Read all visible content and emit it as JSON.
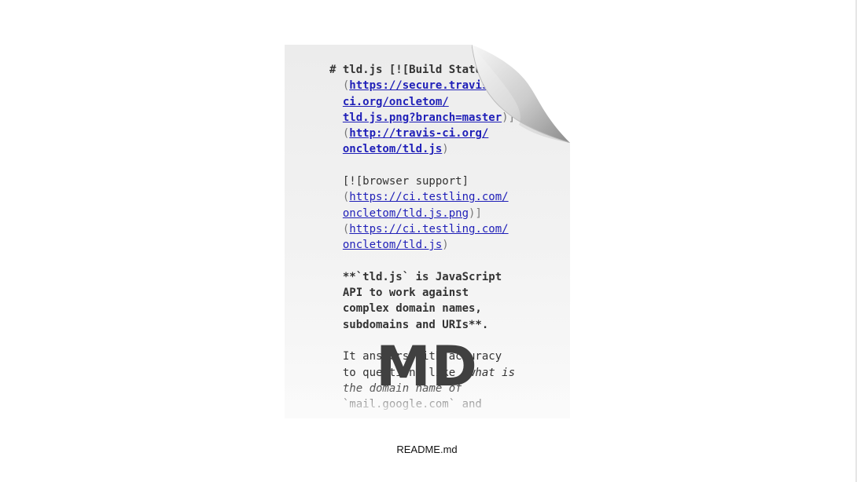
{
  "file": {
    "name": "README.md",
    "type_badge": "MD"
  },
  "preview": {
    "lines": [
      {
        "parts": [
          {
            "t": "# ",
            "c": "b"
          },
          {
            "t": "tld.js ",
            "c": "b"
          },
          {
            "t": "[![Build Status]",
            "c": "b"
          }
        ]
      },
      {
        "parts": [
          {
            "t": "  (",
            "c": "gray"
          },
          {
            "t": "https://secure.travis-",
            "c": "lnk"
          }
        ]
      },
      {
        "parts": [
          {
            "t": "  ",
            "c": ""
          },
          {
            "t": "ci.org/oncletom/",
            "c": "lnk"
          }
        ]
      },
      {
        "parts": [
          {
            "t": "  ",
            "c": ""
          },
          {
            "t": "tld.js.png?branch=master",
            "c": "lnk"
          },
          {
            "t": ")]",
            "c": "gray"
          }
        ]
      },
      {
        "parts": [
          {
            "t": "  (",
            "c": "gray"
          },
          {
            "t": "http://travis-ci.org/",
            "c": "lnk"
          }
        ]
      },
      {
        "parts": [
          {
            "t": "  ",
            "c": ""
          },
          {
            "t": "oncletom/tld.js",
            "c": "lnk"
          },
          {
            "t": ")",
            "c": "gray"
          }
        ]
      },
      {
        "parts": [
          {
            "t": " ",
            "c": ""
          }
        ]
      },
      {
        "parts": [
          {
            "t": "  [![browser support]",
            "c": ""
          }
        ]
      },
      {
        "parts": [
          {
            "t": "  (",
            "c": "gray"
          },
          {
            "t": "https://ci.testling.com/",
            "c": "lnk2"
          }
        ]
      },
      {
        "parts": [
          {
            "t": "  ",
            "c": ""
          },
          {
            "t": "oncletom/tld.js.png",
            "c": "lnk2"
          },
          {
            "t": ")]",
            "c": "gray"
          }
        ]
      },
      {
        "parts": [
          {
            "t": "  (",
            "c": "gray"
          },
          {
            "t": "https://ci.testling.com/",
            "c": "lnk2"
          }
        ]
      },
      {
        "parts": [
          {
            "t": "  ",
            "c": ""
          },
          {
            "t": "oncletom/tld.js",
            "c": "lnk2"
          },
          {
            "t": ")",
            "c": "gray"
          }
        ]
      },
      {
        "parts": [
          {
            "t": " ",
            "c": ""
          }
        ]
      },
      {
        "parts": [
          {
            "t": "  **`tld.js` is JavaScript",
            "c": "b"
          }
        ]
      },
      {
        "parts": [
          {
            "t": "  API to work against",
            "c": "b"
          }
        ]
      },
      {
        "parts": [
          {
            "t": "  complex domain names,",
            "c": "b"
          }
        ]
      },
      {
        "parts": [
          {
            "t": "  subdomains and URIs**.",
            "c": "b"
          }
        ]
      },
      {
        "parts": [
          {
            "t": " ",
            "c": ""
          }
        ]
      },
      {
        "parts": [
          {
            "t": "  It answers with accuracy",
            "c": ""
          }
        ]
      },
      {
        "parts": [
          {
            "t": "  to questions like ",
            "c": ""
          },
          {
            "t": "*what is",
            "c": "it"
          }
        ]
      },
      {
        "parts": [
          {
            "t": "  the domain name of",
            "c": "it"
          }
        ]
      },
      {
        "parts": [
          {
            "t": "  `mail.google.com` and",
            "c": ""
          }
        ]
      }
    ]
  },
  "colors": {
    "link": "#1f1fb8",
    "badge": "#404040"
  }
}
